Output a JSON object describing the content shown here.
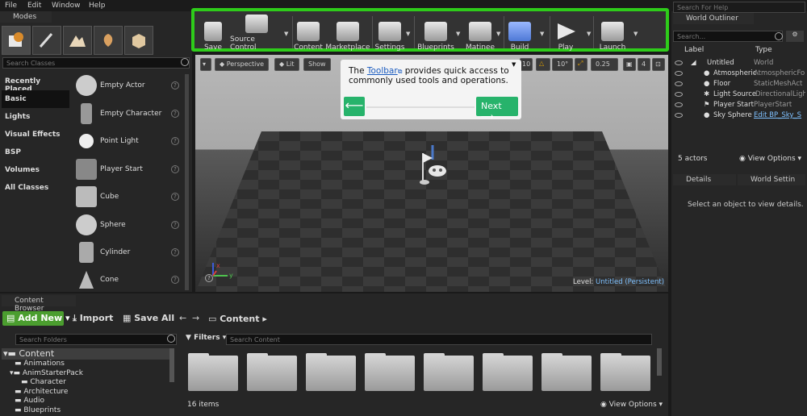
{
  "menu": [
    "File",
    "Edit",
    "Window",
    "Help"
  ],
  "modes": {
    "tab": "Modes",
    "search_placeholder": "Search Classes",
    "categories": [
      "Recently Placed",
      "Basic",
      "Lights",
      "Visual Effects",
      "BSP",
      "Volumes",
      "All Classes"
    ],
    "items": [
      "Empty Actor",
      "Empty Character",
      "Point Light",
      "Player Start",
      "Cube",
      "Sphere",
      "Cylinder",
      "Cone"
    ]
  },
  "toolbar": {
    "buttons": [
      "Save",
      "Source Control",
      "Content",
      "Marketplace",
      "Settings",
      "Blueprints",
      "Matinee",
      "Build",
      "Play",
      "Launch"
    ],
    "highlight_color": "#2ecc1a"
  },
  "viewport": {
    "perspective": "Perspective",
    "lit": "Lit",
    "show": "Show",
    "grid_snap": "10",
    "rot_snap": "10°",
    "scale_snap": "0.25",
    "cam_speed": "4",
    "level_label": "Level:",
    "level_name": "Untitled (Persistent)"
  },
  "tooltip": {
    "pre": "The ",
    "link": "Toolbar",
    "post": " provides quick access to commonly used tools and operations.",
    "next": "Next"
  },
  "outliner": {
    "search_help": "Search For Help",
    "tab": "World Outliner",
    "search_placeholder": "Search...",
    "col_label": "Label",
    "col_type": "Type",
    "rows": [
      {
        "label": "Untitled",
        "type": "World"
      },
      {
        "label": "Atmospheric",
        "type": "AtmosphericFo"
      },
      {
        "label": "Floor",
        "type": "StaticMeshAct"
      },
      {
        "label": "Light Source",
        "type": "DirectionalLight"
      },
      {
        "label": "Player Start",
        "type": "PlayerStart"
      },
      {
        "label": "Sky Sphere",
        "type": "Edit BP_Sky_S"
      }
    ],
    "actor_count": "5 actors",
    "view_options": "View Options"
  },
  "details": {
    "tab": "Details",
    "tab2": "World Settin",
    "empty": "Select an object to view details."
  },
  "content_browser": {
    "tab": "Content Browser",
    "add_new": "Add New",
    "import": "Import",
    "save_all": "Save All",
    "path": "Content",
    "search_folders": "Search Folders",
    "filters": "Filters",
    "search_content": "Search Content",
    "tree": [
      "Content",
      "Animations",
      "AnimStarterPack",
      "Character",
      "Architecture",
      "Audio",
      "Blueprints"
    ],
    "item_count": "16 items",
    "view_options": "View Options"
  }
}
